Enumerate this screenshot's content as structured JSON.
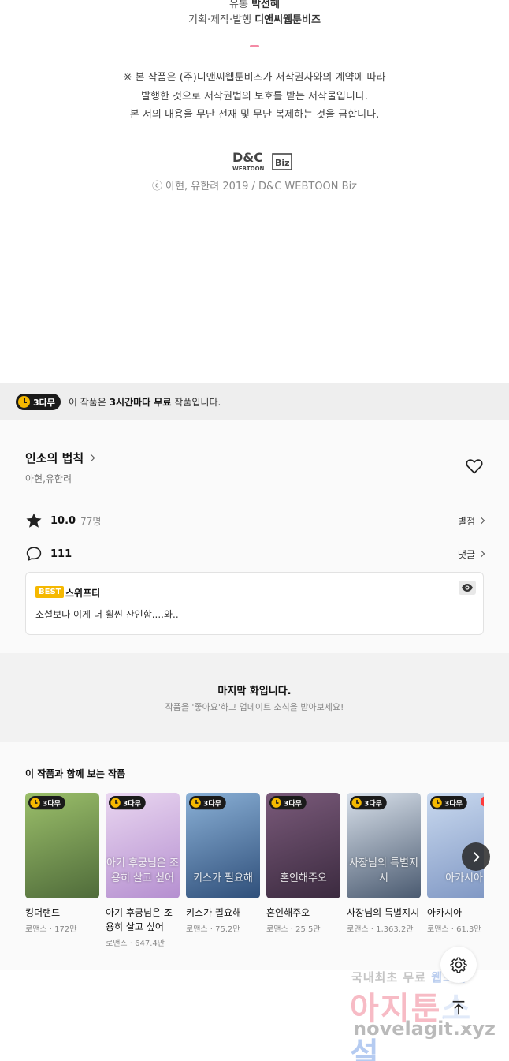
{
  "credits": {
    "line1_label": "유통",
    "line1_value": "박선혜",
    "line2_label": "기획·제작·발행",
    "line2_value": "디앤씨웹툰비즈",
    "notice_1": "※ 본 작품은 (주)디앤씨웹툰비즈가 저작권자와의 계약에 따라",
    "notice_2": "발행한 것으로 저작권법의 보호를 받는 저작물입니다.",
    "notice_3": "본 서의 내용을 무단 전재 및 무단 복제하는 것을 금합니다.",
    "logo_top": "D&C",
    "logo_bottom": "WEBTOON",
    "logo_biz": "Biz",
    "copyright": "ⓒ 아현, 유한려 2019 / D&C WEBTOON Biz"
  },
  "free_banner": {
    "badge": "3다무",
    "text_prefix": "이 작품은 ",
    "text_bold": "3시간마다 무료",
    "text_suffix": " 작품입니다."
  },
  "work": {
    "title": "인소의 법칙",
    "authors": "아현,유한려",
    "rating": "10.0",
    "rating_count": "77명",
    "rating_link": "별점",
    "comment_count": "111",
    "comment_link": "댓글"
  },
  "best_comment": {
    "badge": "BEST",
    "user": "스위프티",
    "text": "소설보다 이게 더 훨씬 잔인함....와.."
  },
  "last_episode": {
    "title": "마지막 화입니다.",
    "subtitle": "작품을 '좋아요'하고 업데이트 소식을 받아보세요!"
  },
  "recommendations": {
    "title": "이 작품과 함께 보는 작품",
    "badge": "3다무",
    "up_label": "UP",
    "items": [
      {
        "name": "킹더랜드",
        "meta": "로맨스 · 172만",
        "cover_text": "",
        "color_a": "#9bbf6a",
        "color_b": "#4f6b3a"
      },
      {
        "name": "아기 후궁님은 조용히 살고 싶어",
        "meta": "로맨스 · 647.4만",
        "cover_text": "아기 후궁님은 조용히 살고 싶어",
        "color_a": "#e9d6f0",
        "color_b": "#b58fd0"
      },
      {
        "name": "키스가 필요해",
        "meta": "로맨스 · 75.2만",
        "cover_text": "키스가 필요해",
        "color_a": "#8ab0d6",
        "color_b": "#2f4f7a"
      },
      {
        "name": "혼인해주오",
        "meta": "로맨스 · 25.5만",
        "cover_text": "혼인해주오",
        "color_a": "#7a5a7a",
        "color_b": "#3b2a3f"
      },
      {
        "name": "사장님의 특별지시",
        "meta": "로맨스 · 1,363.2만",
        "cover_text": "사장님의 특별지시",
        "color_a": "#d8e0ea",
        "color_b": "#4a5a70"
      },
      {
        "name": "아카시아",
        "meta": "로맨스 · 61.3만",
        "cover_text": "아카시아",
        "color_a": "#c9d9ef",
        "color_b": "#7d95c2"
      }
    ]
  },
  "watermark": {
    "line1a": "국내최초 무료 ",
    "line1b": "웹소설",
    "line2a": "아지툰",
    "line2b": "소설",
    "line3": "novelagit.xyz"
  },
  "icons": [
    "clock-icon",
    "heart-icon",
    "star-icon",
    "comment-icon",
    "eye-icon",
    "chevron-right-icon",
    "gear-icon",
    "arrow-up-icon"
  ],
  "colors": {
    "badge_yellow": "#f5b800",
    "badge_dark": "#1a1a1a",
    "accent_pink": "#f48aa5",
    "up_red": "#ff3b3b"
  }
}
